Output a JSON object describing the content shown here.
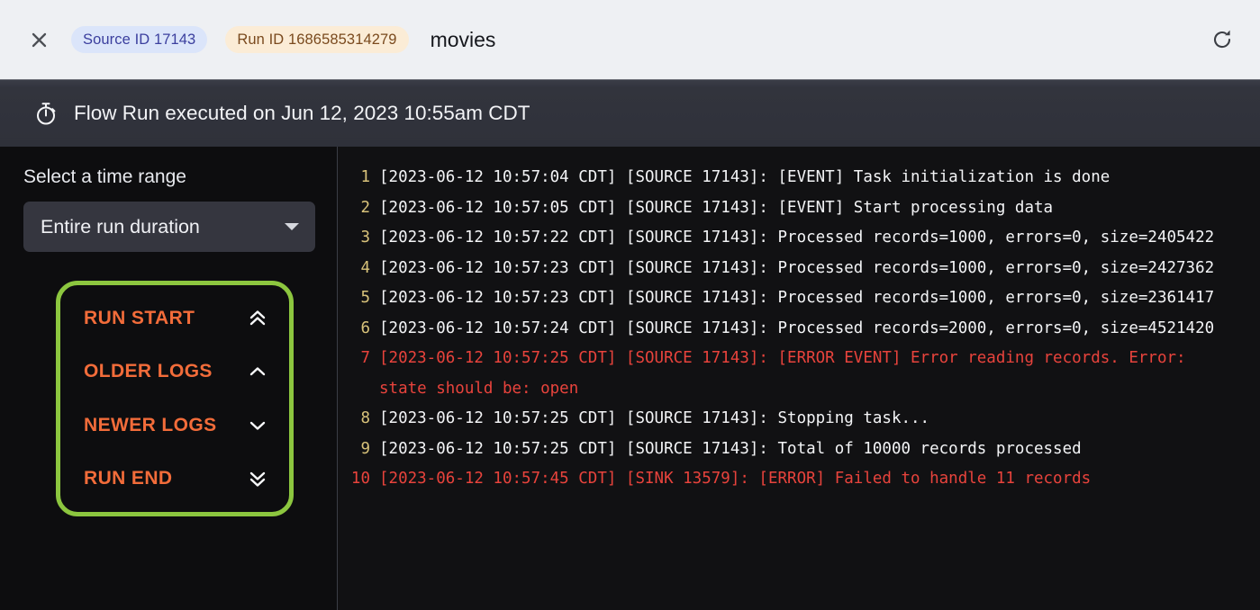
{
  "topbar": {
    "close_icon": "close-icon",
    "source_badge": "Source ID 17143",
    "run_badge": "Run ID 1686585314279",
    "title": "movies",
    "refresh_icon": "refresh-icon"
  },
  "banner": {
    "icon": "stopwatch-icon",
    "text": "Flow Run executed on Jun 12, 2023 10:55am CDT"
  },
  "sidebar": {
    "time_range_label": "Select a time range",
    "time_range_value": "Entire run duration",
    "chevron_icon": "chevron-down-icon",
    "nav_items": [
      {
        "label": "RUN START",
        "icon": "chevrons-up-icon"
      },
      {
        "label": "OLDER LOGS",
        "icon": "chevron-up-icon"
      },
      {
        "label": "NEWER LOGS",
        "icon": "chevron-down-icon"
      },
      {
        "label": "RUN END",
        "icon": "chevrons-down-icon"
      }
    ]
  },
  "logs": [
    {
      "num": "1",
      "text": "[2023-06-12 10:57:04 CDT] [SOURCE 17143]: [EVENT] Task initialization is done",
      "error": false
    },
    {
      "num": "2",
      "text": "[2023-06-12 10:57:05 CDT] [SOURCE 17143]: [EVENT] Start processing data",
      "error": false
    },
    {
      "num": "3",
      "text": "[2023-06-12 10:57:22 CDT] [SOURCE 17143]: Processed records=1000, errors=0, size=2405422",
      "error": false
    },
    {
      "num": "4",
      "text": "[2023-06-12 10:57:23 CDT] [SOURCE 17143]: Processed records=1000, errors=0, size=2427362",
      "error": false
    },
    {
      "num": "5",
      "text": "[2023-06-12 10:57:23 CDT] [SOURCE 17143]: Processed records=1000, errors=0, size=2361417",
      "error": false
    },
    {
      "num": "6",
      "text": "[2023-06-12 10:57:24 CDT] [SOURCE 17143]: Processed records=2000, errors=0, size=4521420",
      "error": false
    },
    {
      "num": "7",
      "text": "[2023-06-12 10:57:25 CDT] [SOURCE 17143]: [ERROR EVENT] Error reading records. Error: state should be: open",
      "error": true
    },
    {
      "num": "8",
      "text": "[2023-06-12 10:57:25 CDT] [SOURCE 17143]: Stopping task...",
      "error": false
    },
    {
      "num": "9",
      "text": "[2023-06-12 10:57:25 CDT] [SOURCE 17143]: Total of 10000 records processed",
      "error": false
    },
    {
      "num": "10",
      "text": "[2023-06-12 10:57:45 CDT] [SINK 13579]: [ERROR] Failed to handle 11 records",
      "error": true
    }
  ],
  "colors": {
    "highlight_green": "#8cc63f",
    "nav_orange": "#f26c3a",
    "error_red": "#e8433c",
    "line_number": "#d8c27a",
    "topbar_bg": "#eef0f3",
    "banner_bg": "#32343d",
    "log_bg": "#111113"
  }
}
